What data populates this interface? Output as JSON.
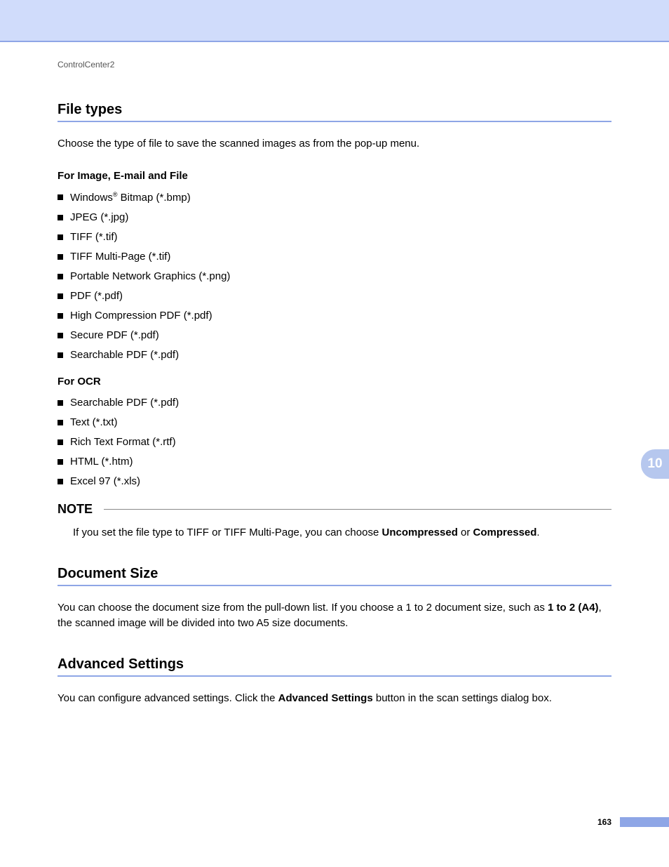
{
  "breadcrumb": "ControlCenter2",
  "sections": {
    "file_types": {
      "heading": "File types",
      "intro": "Choose the type of file to save the scanned images as from the pop-up menu.",
      "group_a_head": "For Image, E-mail and File",
      "group_a_items": {
        "i0_pre": "Windows",
        "i0_sup": "®",
        "i0_post": " Bitmap (*.bmp)",
        "i1": "JPEG (*.jpg)",
        "i2": "TIFF (*.tif)",
        "i3": "TIFF Multi-Page (*.tif)",
        "i4": "Portable Network Graphics (*.png)",
        "i5": "PDF (*.pdf)",
        "i6": "High Compression PDF (*.pdf)",
        "i7": "Secure PDF (*.pdf)",
        "i8": "Searchable PDF (*.pdf)"
      },
      "group_b_head": "For OCR",
      "group_b_items": {
        "i0": "Searchable PDF (*.pdf)",
        "i1": "Text (*.txt)",
        "i2": "Rich Text Format (*.rtf)",
        "i3": "HTML (*.htm)",
        "i4": "Excel 97 (*.xls)"
      },
      "note_label": "NOTE",
      "note_pre": "If you set the file type to TIFF or TIFF Multi-Page, you can choose ",
      "note_bold1": "Uncompressed",
      "note_mid": " or ",
      "note_bold2": "Compressed",
      "note_end": "."
    },
    "doc_size": {
      "heading": "Document Size",
      "para_pre": "You can choose the document size from the pull-down list. If you choose a 1 to 2 document size, such as ",
      "para_bold": "1 to 2 (A4)",
      "para_post": ", the scanned image will be divided into two A5 size documents."
    },
    "adv": {
      "heading": "Advanced Settings",
      "para_pre": "You can configure advanced settings. Click the ",
      "para_bold": "Advanced Settings",
      "para_post": " button in the scan settings dialog box."
    }
  },
  "chapter_tab": "10",
  "page_number": "163"
}
